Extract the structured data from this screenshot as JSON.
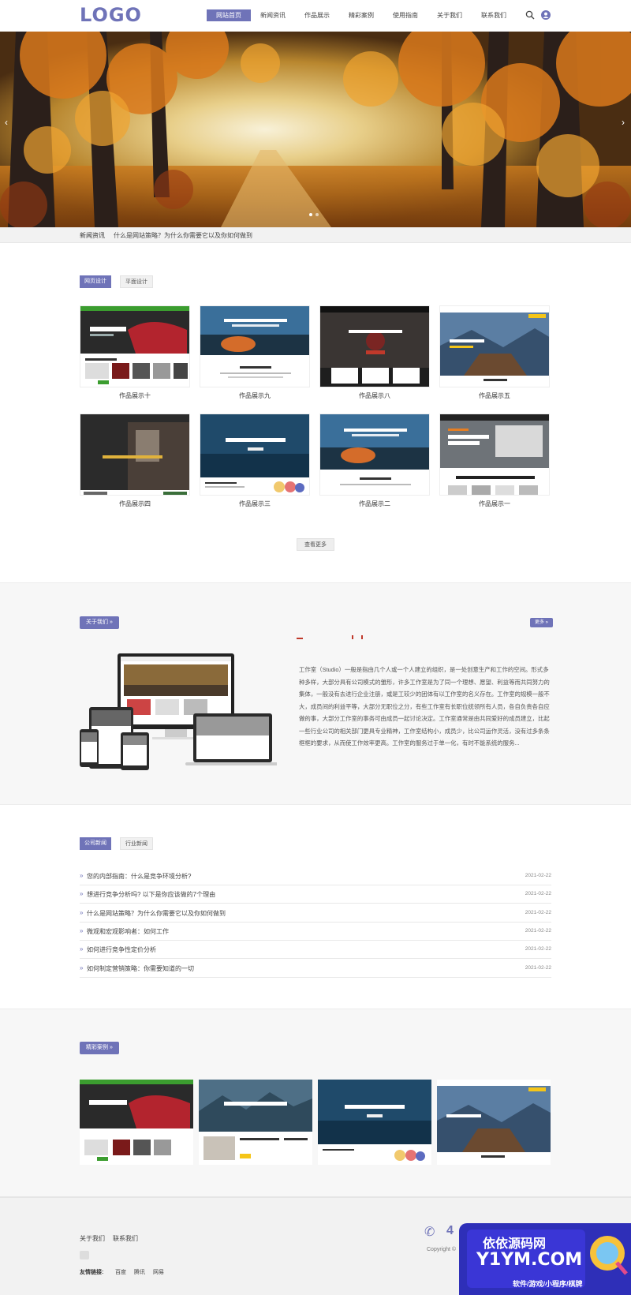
{
  "header": {
    "logo": "LOGO",
    "nav": [
      "网站首页",
      "新闻资讯",
      "作品展示",
      "精彩案例",
      "使用指南",
      "关于我们",
      "联系我们"
    ],
    "active_index": 0
  },
  "ticker": {
    "label": "新闻资讯",
    "text": "什么是网站策略？为什么你需要它以及你如何做到"
  },
  "works": {
    "tabs": [
      "网页设计",
      "平面设计"
    ],
    "items": [
      "作品展示十",
      "作品展示九",
      "作品展示八",
      "作品展示五",
      "作品展示四",
      "作品展示三",
      "作品展示二",
      "作品展示一"
    ],
    "more_label": "查看更多"
  },
  "about": {
    "title_label": "关于我们 »",
    "more_label": "更多 »",
    "text": "工作室（Studio）一般是指由几个人或一个人建立的组织，是一处创意生产和工作的空间。形式多种多样，大部分具有公司模式的雏形，许多工作室是为了同一个理想、愿望、利益等而共同努力的集体，一般没有去进行企业注册，或是工较少的团体有以工作室的名义存在。工作室的规模一般不大，成员间的利益平等，大部分无职位之分，有些工作室有长职位统领所有人员，各自负责各自应做的事，大部分工作室的事务可由成员一起讨论决定。工作室通常是由共同爱好的成员建立，比起一些行业公司的相关部门更具专业精神，工作室结构小，成员少，比公司运作灵活，没有过多条条框框的要求，从而使工作效率更高。工作室的服务过于单一化，有时不能系统的服务..."
  },
  "news": {
    "tabs": [
      "公司新闻",
      "行业新闻"
    ],
    "items": [
      {
        "title": "您的内部指南：什么是竞争环境分析?",
        "date": "2021-02-22"
      },
      {
        "title": "想进行竞争分析吗? 以下是你应该做的7个理由",
        "date": "2021-02-22"
      },
      {
        "title": "什么是网站策略？为什么你需要它以及你如何做到",
        "date": "2021-02-22"
      },
      {
        "title": "微观和宏观影响者：如何工作",
        "date": "2021-02-22"
      },
      {
        "title": "如何进行竞争性定价分析",
        "date": "2021-02-22"
      },
      {
        "title": "如何制定营销策略：你需要知道的一切",
        "date": "2021-02-22"
      }
    ]
  },
  "cases": {
    "title_label": "精彩案例 »"
  },
  "footer": {
    "links": [
      "关于我们",
      "联系我们"
    ],
    "friend_label": "友情链接:",
    "friends": [
      "百度",
      "腾讯",
      "网易"
    ],
    "copyright": "Copyright ©",
    "phone_prefix": "4"
  },
  "watermark": {
    "line1": "依依源码网",
    "line2": "Y1YM.COM",
    "line3": "软件/游戏/小程序/棋牌"
  },
  "colors": {
    "accent": "#6f73b8",
    "news_bullet": "#6f73b8"
  }
}
